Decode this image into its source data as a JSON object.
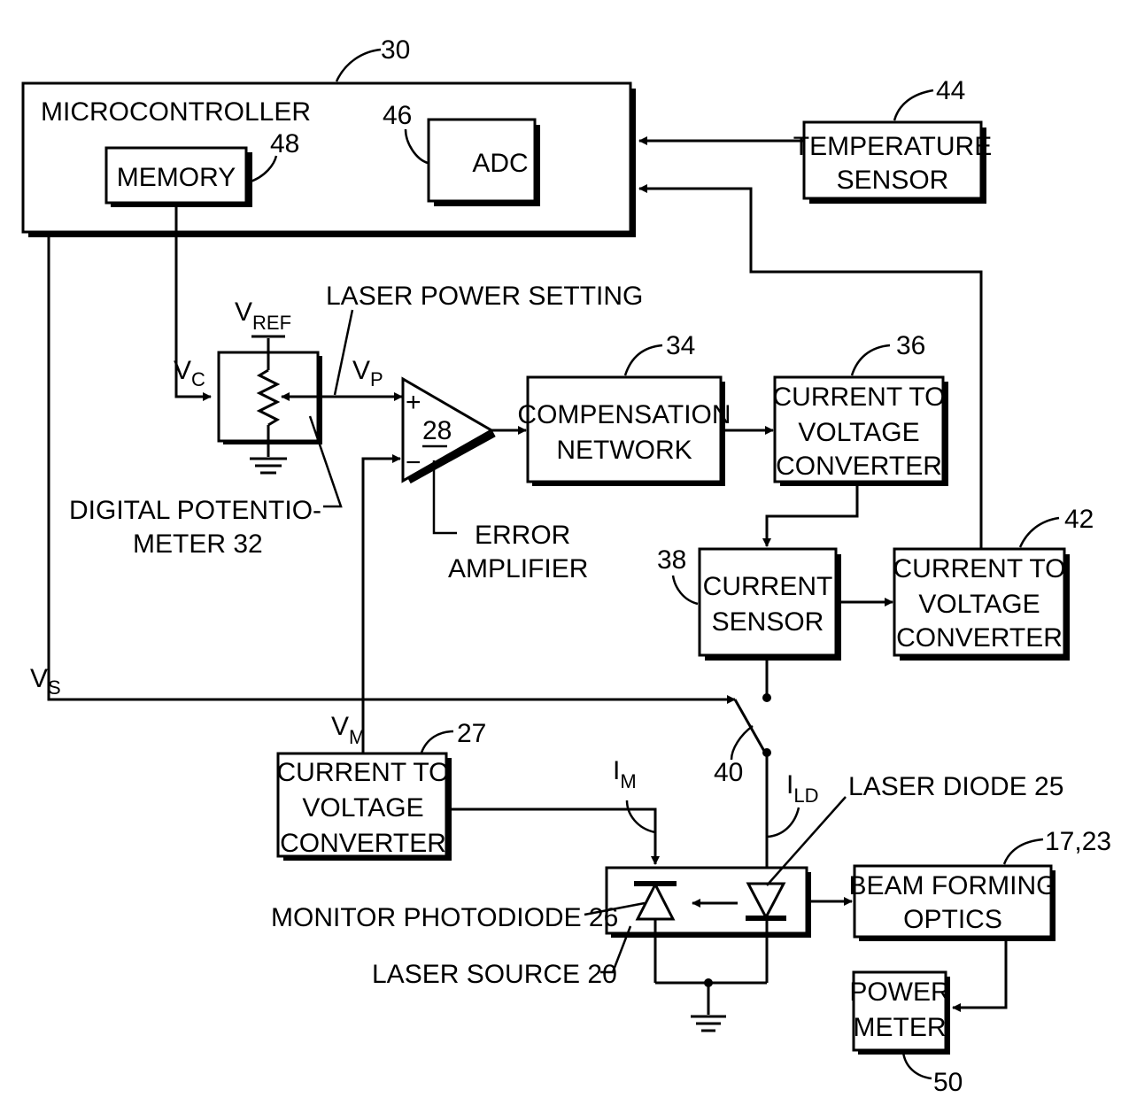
{
  "figure": {
    "blocks": {
      "microcontroller": {
        "label": "MICROCONTROLLER",
        "ref": "30"
      },
      "memory": {
        "label": "MEMORY",
        "ref": "48"
      },
      "adc": {
        "label": "ADC",
        "ref": "46"
      },
      "temperature_sensor": {
        "line1": "TEMPERATURE",
        "line2": "SENSOR",
        "ref": "44"
      },
      "compensation_network": {
        "line1": "COMPENSATION",
        "line2": "NETWORK",
        "ref": "34"
      },
      "converter_36": {
        "line1": "CURRENT TO",
        "line2": "VOLTAGE",
        "line3": "CONVERTER",
        "ref": "36"
      },
      "current_sensor": {
        "line1": "CURRENT",
        "line2": "SENSOR",
        "ref": "38"
      },
      "converter_42": {
        "line1": "CURRENT TO",
        "line2": "VOLTAGE",
        "line3": "CONVERTER",
        "ref": "42"
      },
      "converter_27": {
        "line1": "CURRENT TO",
        "line2": "VOLTAGE",
        "line3": "CONVERTER",
        "ref": "27"
      },
      "beam_forming_optics": {
        "line1": "BEAM FORMING",
        "line2": "OPTICS",
        "ref": "17,23"
      },
      "power_meter": {
        "line1": "POWER",
        "line2": "METER",
        "ref": "50"
      }
    },
    "amplifier": {
      "ref": "28",
      "plus": "+",
      "minus": "−",
      "label_line1": "ERROR",
      "label_line2": "AMPLIFIER"
    },
    "potentiometer": {
      "label_line1": "DIGITAL POTENTIO-",
      "label_line2": "METER 32"
    },
    "labels": {
      "laser_power_setting": "LASER POWER SETTING",
      "laser_diode": "LASER DIODE 25",
      "monitor_photodiode": "MONITOR PHOTODIODE 26",
      "laser_source": "LASER SOURCE 20",
      "switch_ref": "40"
    },
    "signals": {
      "vref": {
        "main": "V",
        "sub": "REF"
      },
      "vc": {
        "main": "V",
        "sub": "C"
      },
      "vp": {
        "main": "V",
        "sub": "P"
      },
      "vs": {
        "main": "V",
        "sub": "S"
      },
      "vm": {
        "main": "V",
        "sub": "M"
      },
      "im": {
        "main": "I",
        "sub": "M"
      },
      "ild": {
        "main": "I",
        "sub": "LD"
      }
    }
  }
}
